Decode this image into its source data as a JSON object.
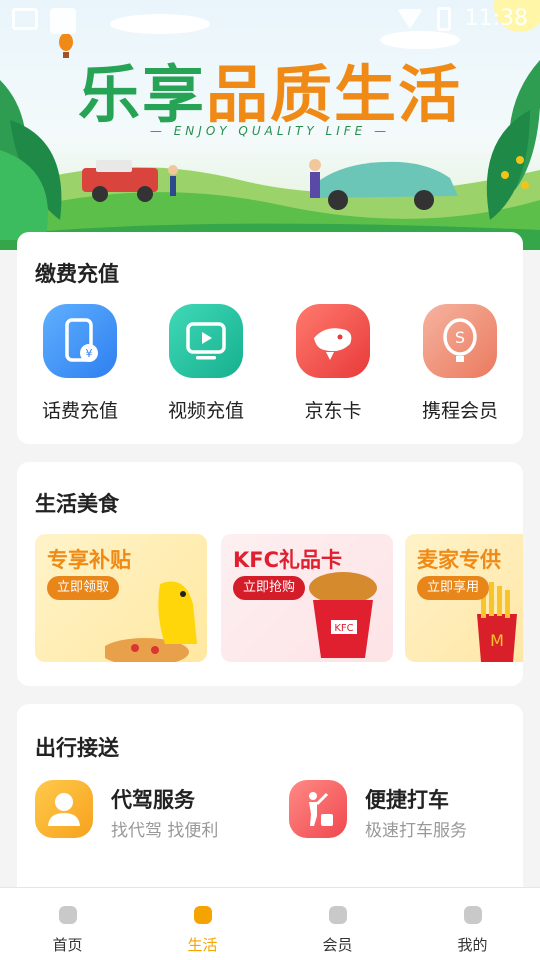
{
  "status_bar": {
    "time": "11:38"
  },
  "banner": {
    "title_part1": "乐享",
    "title_part2": "品质生活",
    "subtitle": "— ENJOY QUALITY LIFE —"
  },
  "payment": {
    "title": "缴费充值",
    "items": [
      {
        "label": "话费充值",
        "icon": "phone-recharge-icon",
        "color": "#3e95f5"
      },
      {
        "label": "视频充值",
        "icon": "video-play-icon",
        "color": "#22c0a3"
      },
      {
        "label": "京东卡",
        "icon": "jd-dog-icon",
        "color": "#f04b4b"
      },
      {
        "label": "携程会员",
        "icon": "ctrip-balloon-icon",
        "color": "#ef8d74"
      }
    ]
  },
  "food": {
    "title": "生活美食",
    "tiles": [
      {
        "title": "专享补贴",
        "button": "立即领取"
      },
      {
        "title": "KFC礼品卡",
        "button": "立即抢购"
      },
      {
        "title": "麦家专供",
        "button": "立即享用"
      }
    ]
  },
  "travel": {
    "title": "出行接送",
    "items": [
      {
        "name": "代驾服务",
        "desc": "找代驾 找便利",
        "icon": "driver-person-icon"
      },
      {
        "name": "便捷打车",
        "desc": "极速打车服务",
        "icon": "taxi-hail-icon"
      }
    ]
  },
  "nav": {
    "items": [
      {
        "label": "首页",
        "icon": "home-icon",
        "active": false
      },
      {
        "label": "生活",
        "icon": "life-icon",
        "active": true
      },
      {
        "label": "会员",
        "icon": "member-icon",
        "active": false
      },
      {
        "label": "我的",
        "icon": "profile-icon",
        "active": false
      }
    ]
  },
  "colors": {
    "accent": "#f5a300",
    "brand_green": "#27a356",
    "brand_orange": "#f08a16"
  }
}
